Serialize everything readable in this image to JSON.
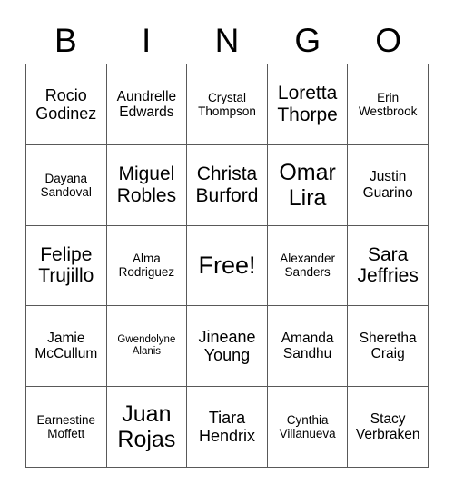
{
  "card": {
    "header_letters": [
      "B",
      "I",
      "N",
      "G",
      "O"
    ],
    "free_space_label": "Free!",
    "colors": {
      "background": "#ffffff",
      "grid_line": "#595959",
      "text": "#000000"
    },
    "columns": [
      {
        "letter": "B",
        "cells": [
          {
            "name": "Rocio\nGodinez",
            "size": "l"
          },
          {
            "name": "Dayana\nSandoval",
            "size": "s"
          },
          {
            "name": "Felipe\nTrujillo",
            "size": "xl"
          },
          {
            "name": "Jamie\nMcCullum",
            "size": "m"
          },
          {
            "name": "Earnestine\nMoffett",
            "size": "s"
          }
        ]
      },
      {
        "letter": "I",
        "cells": [
          {
            "name": "Aundrelle\nEdwards",
            "size": "m"
          },
          {
            "name": "Miguel\nRobles",
            "size": "xl"
          },
          {
            "name": "Alma\nRodriguez",
            "size": "s"
          },
          {
            "name": "Gwendolyne\nAlanis",
            "size": "xs"
          },
          {
            "name": "Juan\nRojas",
            "size": "xxl"
          }
        ]
      },
      {
        "letter": "N",
        "cells": [
          {
            "name": "Crystal\nThompson",
            "size": "s"
          },
          {
            "name": "Christa\nBurford",
            "size": "xl"
          },
          {
            "name": "Free!",
            "size": "free"
          },
          {
            "name": "Jineane\nYoung",
            "size": "l"
          },
          {
            "name": "Tiara\nHendrix",
            "size": "l"
          }
        ]
      },
      {
        "letter": "G",
        "cells": [
          {
            "name": "Loretta\nThorpe",
            "size": "xl"
          },
          {
            "name": "Omar\nLira",
            "size": "xxl"
          },
          {
            "name": "Alexander\nSanders",
            "size": "s"
          },
          {
            "name": "Amanda\nSandhu",
            "size": "m"
          },
          {
            "name": "Cynthia\nVillanueva",
            "size": "s"
          }
        ]
      },
      {
        "letter": "O",
        "cells": [
          {
            "name": "Erin\nWestbrook",
            "size": "s"
          },
          {
            "name": "Justin\nGuarino",
            "size": "m"
          },
          {
            "name": "Sara\nJeffries",
            "size": "xl"
          },
          {
            "name": "Sheretha\nCraig",
            "size": "m"
          },
          {
            "name": "Stacy\nVerbraken",
            "size": "m"
          }
        ]
      }
    ]
  }
}
